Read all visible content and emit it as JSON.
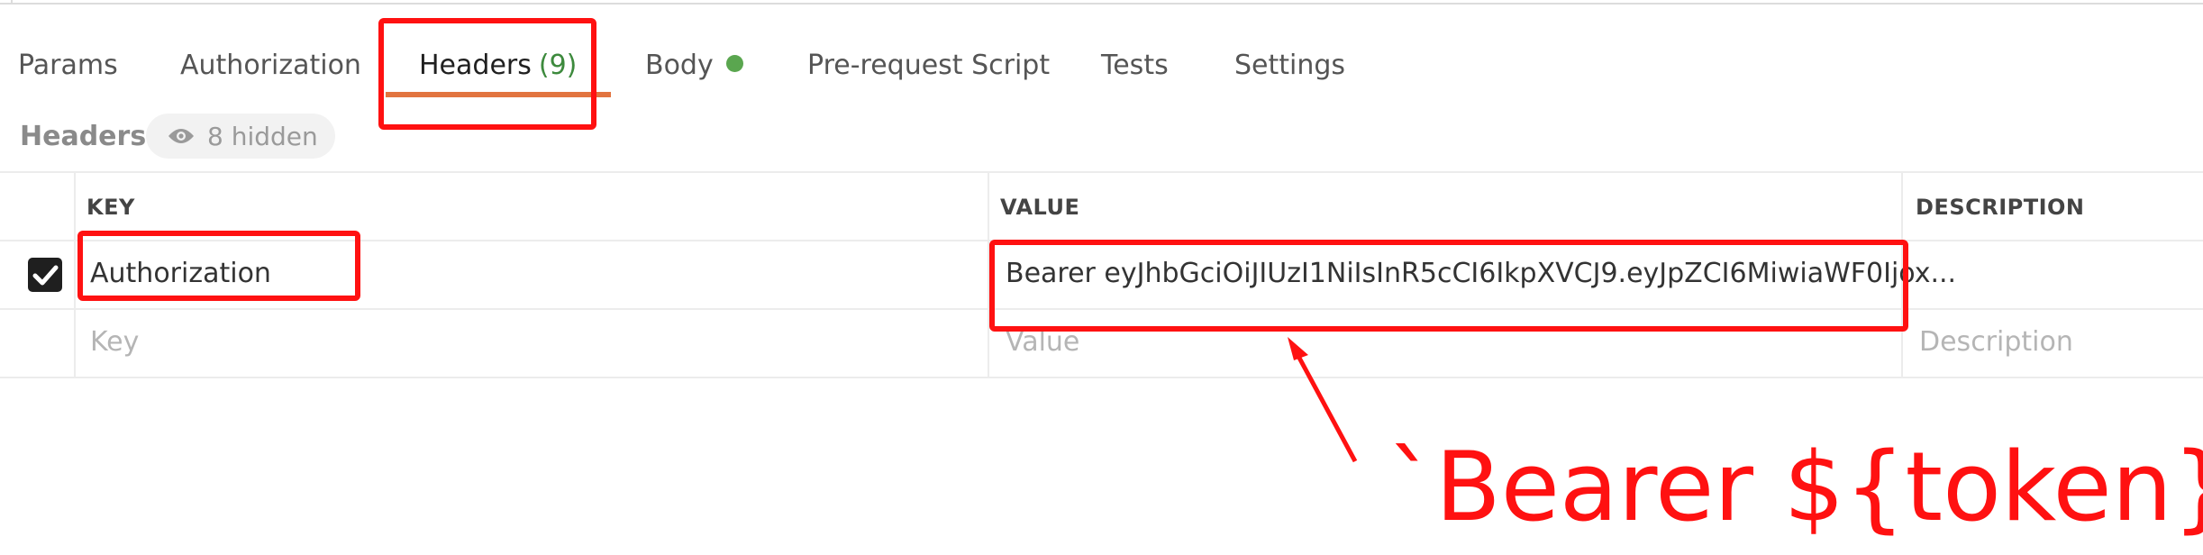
{
  "tabs": [
    {
      "label": "Params"
    },
    {
      "label": "Authorization"
    },
    {
      "label": "Headers",
      "count": "(9)"
    },
    {
      "label": "Body"
    },
    {
      "label": "Pre-request Script"
    },
    {
      "label": "Tests"
    },
    {
      "label": "Settings"
    }
  ],
  "headers_section": {
    "title": "Headers",
    "hidden_label": "8 hidden"
  },
  "table": {
    "columns": [
      "KEY",
      "VALUE",
      "DESCRIPTION"
    ],
    "rows": [
      {
        "checked": true,
        "key": "Authorization",
        "value": "Bearer eyJhbGciOiJIUzI1NiIsInR5cCI6IkpXVCJ9.eyJpZCI6MiwiaWF0Ijox...",
        "description": ""
      }
    ],
    "new_row": {
      "key_placeholder": "Key",
      "value_placeholder": "Value",
      "description_placeholder": "Description"
    }
  },
  "annotation": {
    "text": "`Bearer ${token}`",
    "color": "#ff1111"
  },
  "colors": {
    "tab_underline": "#e2743f",
    "body_dot": "#5aa64f",
    "count_green": "#3d8a3d"
  }
}
